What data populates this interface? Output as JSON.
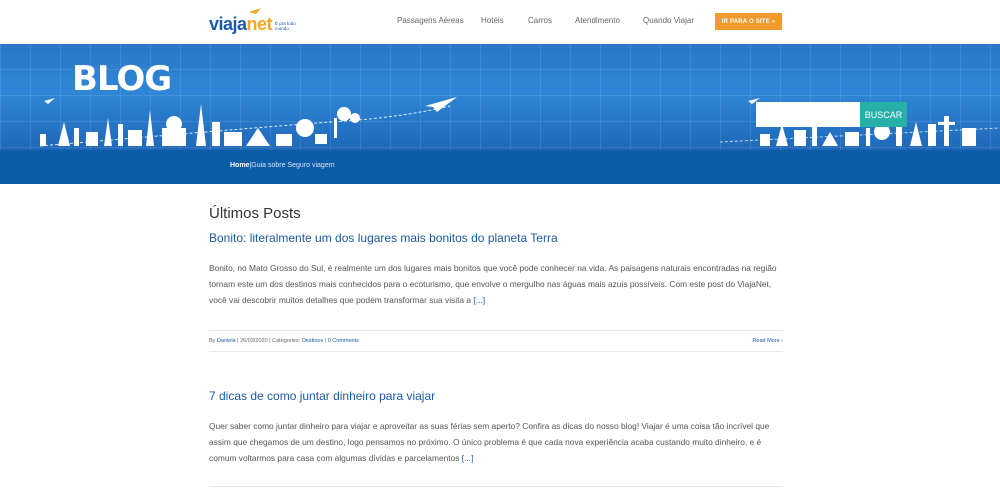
{
  "header": {
    "logo": {
      "part1": "viaja",
      "part2": "net",
      "tagline": "É pra todo mundo."
    },
    "nav": [
      {
        "label": "Passagens Aéreas"
      },
      {
        "label": "Hotéis"
      },
      {
        "label": "Carros"
      },
      {
        "label": "Atendimento"
      },
      {
        "label": "Quando Viajar"
      }
    ],
    "site_button": "IR PARA O SITE »"
  },
  "banner": {
    "title": "BLOG",
    "search": {
      "placeholder": "",
      "value": "",
      "button": "BUSCAR"
    }
  },
  "breadcrumb": {
    "home": "Home",
    "separator": "|",
    "current": "Guia sobre Seguro viagem"
  },
  "main": {
    "section_title": "Últimos Posts",
    "posts": [
      {
        "title": "Bonito: literalmente um dos lugares mais bonitos do planeta Terra",
        "excerpt": "Bonito, no Mato Grosso do Sul, é realmente um dos lugares mais bonitos que você pode conhecer na vida. As paisagens naturais encontradas na região tornam este um dos destinos mais conhecidos para o ecoturismo, que envolve o mergulho nas águas mais azuis possíveis. Com este post do ViajaNet, você vai descobrir muitos detalhes que podem transformar sua visita a",
        "more": "[...]",
        "meta": {
          "by": "By",
          "author": "Daniela",
          "date": "26/03/2020",
          "categories_label": "Categories:",
          "category": "Destinos",
          "comments": "0 Comments",
          "sep": "|"
        },
        "read_more": "Read More ›"
      },
      {
        "title": "7 dicas de como juntar dinheiro para viajar",
        "excerpt": "Quer saber como juntar dinheiro para viajar e aproveitar as suas férias sem aperto? Confira as dicas do nosso blog! Viajar é uma coisa tão incrível que assim que chegamos de um destino, logo pensamos no próximo. O único problema é que cada nova experiência acaba custando muito dinheiro, e é comum voltarmos para casa com algumas dívidas e parcelamentos",
        "more": "[...]"
      }
    ]
  },
  "colors": {
    "brand_blue": "#1a5aa8",
    "brand_orange": "#f29a2e",
    "search_button": "#27b0a8",
    "breadcrumb_bar": "#0d5ca8"
  },
  "icons": [
    "airplane-icon",
    "landmarks-skyline"
  ]
}
